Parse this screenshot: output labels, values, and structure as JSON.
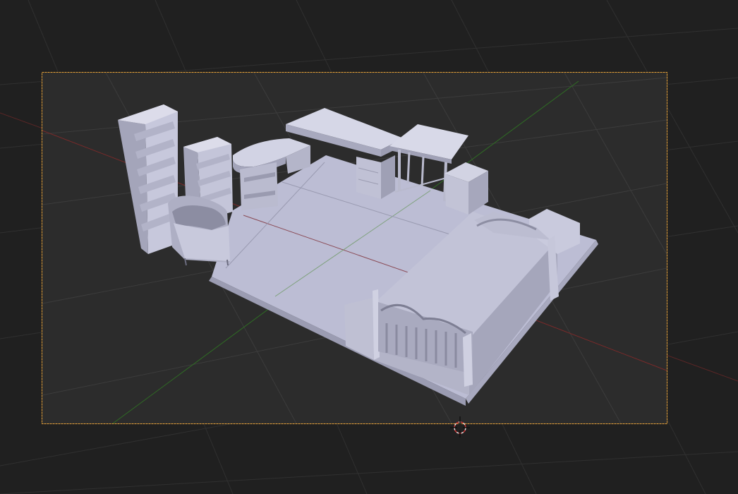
{
  "viewport": {
    "background": "#202020",
    "camera_region_color": "#2b2b2b",
    "camera_frame_color": "#e8a33a",
    "grid_color": "#3a3a3a",
    "x_axis_color": "#a33030",
    "y_axis_color": "#3c8b2a"
  },
  "scene": {
    "object_color": "#c6c7db",
    "object_shadow": "#9a9bb0",
    "object_highlight": "#dcdcea",
    "cursor_icon": "3d-cursor-icon"
  }
}
